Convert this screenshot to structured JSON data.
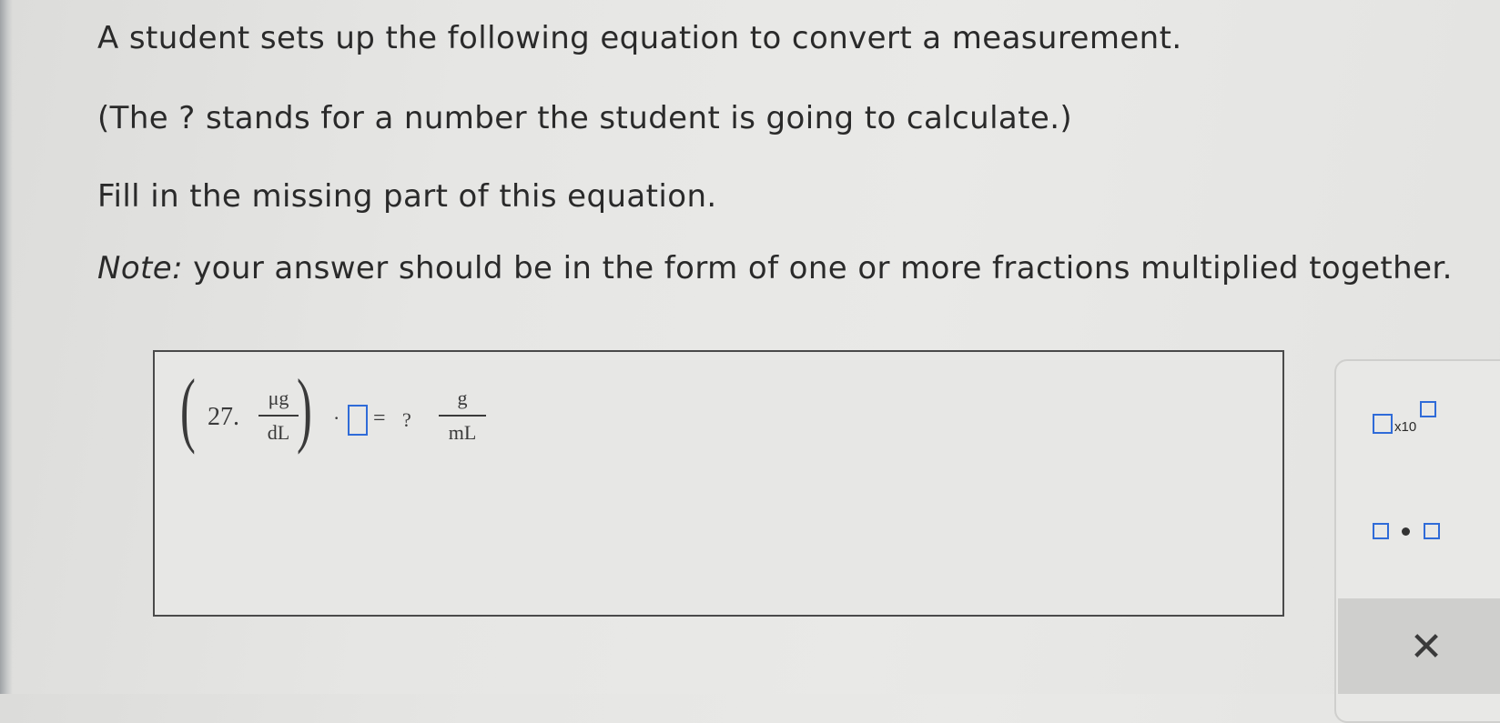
{
  "question": {
    "line1": "A student sets up the following equation to convert a measurement.",
    "line2": "(The ? stands for a number the student is going to calculate.)",
    "line3": "Fill in the missing part of this equation.",
    "note_label": "Note:",
    "note_text": " your answer should be in the form of one or more fractions multiplied together."
  },
  "equation": {
    "open_paren": "(",
    "close_paren": ")",
    "coefficient": "27.",
    "unit1_numerator": "μg",
    "unit1_denominator": "dL",
    "multiply_symbol": "·",
    "equals": "=",
    "unknown": "?",
    "unit2_numerator": "g",
    "unit2_denominator": "mL",
    "input_value": ""
  },
  "toolbox": {
    "sci_notation_label": "x10",
    "clear_symbol": "✕"
  },
  "colors": {
    "input_border": "#2f6bd8",
    "background": "#e6e6e4"
  },
  "icons": [
    "sci-notation-icon",
    "multiply-dot-icon",
    "close-icon"
  ]
}
